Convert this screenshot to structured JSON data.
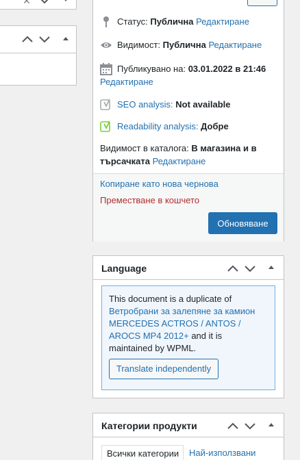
{
  "left_panel": {},
  "publish": {
    "status_label": "Статус:",
    "status_value": "Публична",
    "status_edit": "Редактиране",
    "visibility_label": "Видимост:",
    "visibility_value": "Публична",
    "visibility_edit": "Редактиране",
    "published_label": "Публикувано на:",
    "published_value": "03.01.2022 в 21:46",
    "published_edit": "Редактиране",
    "seo_label": "SEO analysis:",
    "seo_value": "Not available",
    "readability_label": "Readability analysis:",
    "readability_value": "Добре",
    "catalog_label": "Видимост в каталога:",
    "catalog_value": "В магазина и в търсачката",
    "catalog_edit": "Редактиране",
    "copy_draft": "Копиране като нова чернова",
    "trash": "Преместване в кошчето",
    "update_button": "Обновяване"
  },
  "language": {
    "title": "Language",
    "notice_prefix": "This document is a duplicate of",
    "notice_link": "Ветробрани за залепяне за камион MERCEDES ACTROS / ANTOS / AROCS MP4 2012+",
    "notice_suffix": "and it is maintained by WPML.",
    "translate_button": "Translate independently"
  },
  "categories": {
    "title": "Категории продукти",
    "tab_all": "Всички категории",
    "tab_popular": "Най-използвани"
  },
  "colors": {
    "accent": "#2271b1",
    "trash": "#b32d2e",
    "good": "#7ad03a"
  }
}
